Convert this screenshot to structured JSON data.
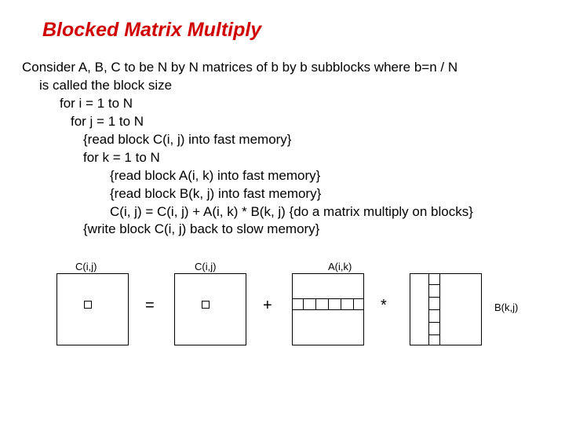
{
  "title": "Blocked Matrix Multiply",
  "line1": "Consider A, B, C to be N by N matrices of b by b subblocks where b=n / N",
  "line1b": "is called the block size",
  "line2": "for i = 1 to N",
  "line3": "for j = 1 to N",
  "line4": "{read block C(i, j) into fast memory}",
  "line5": "for k = 1 to N",
  "line6": "{read block A(i, k) into fast memory}",
  "line7": "{read block B(k, j) into fast memory}",
  "line8": "C(i, j) = C(i, j) + A(i, k) * B(k, j)  {do a matrix multiply on blocks}",
  "line9": "{write block C(i, j) back to slow memory}",
  "diagram": {
    "label_c1": "C(i,j)",
    "label_c2": "C(i,j)",
    "label_a": "A(i,k)",
    "label_b": "B(k,j)",
    "op_eq": "=",
    "op_plus": "+",
    "op_star": "*"
  }
}
